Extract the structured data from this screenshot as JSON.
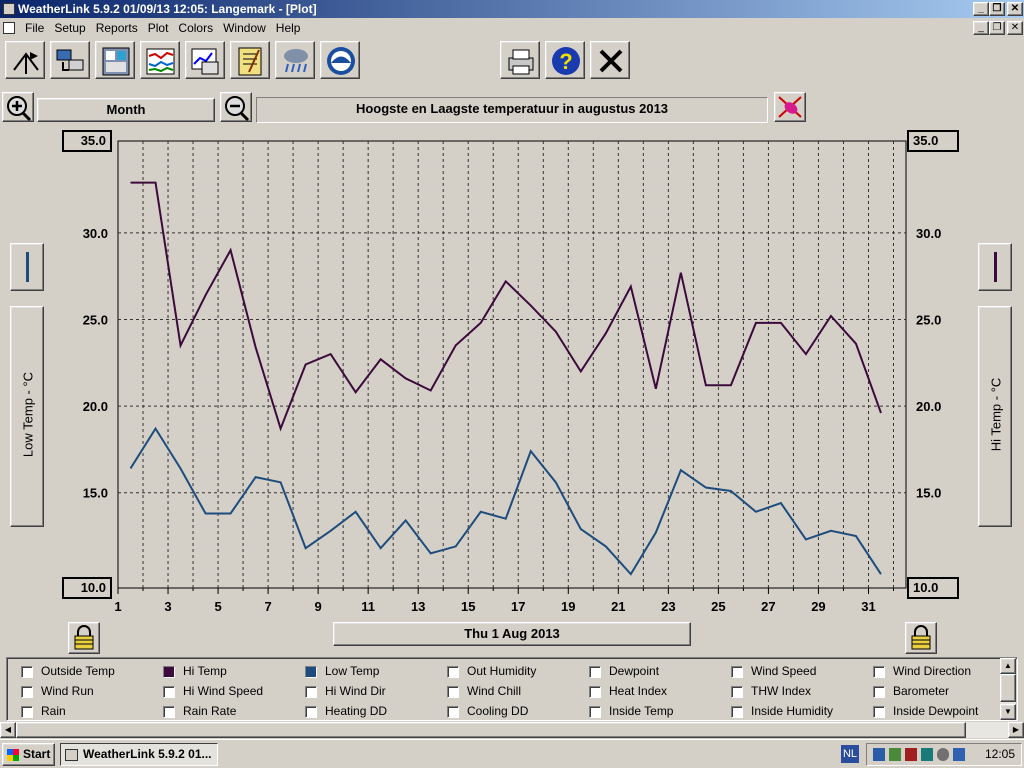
{
  "window": {
    "title": "WeatherLink 5.9.2  01/09/13  12:05: Langemark - [Plot]"
  },
  "menu": [
    "File",
    "Setup",
    "Reports",
    "Plot",
    "Colors",
    "Window",
    "Help"
  ],
  "toolbar": {
    "icons": [
      "station-icon",
      "download-icon",
      "bulletin-icon",
      "strip-chart-icon",
      "plot-icon",
      "notes-icon",
      "weather-icon",
      "noaa-icon"
    ],
    "right_icons": [
      "print-icon",
      "help-icon",
      "close-icon"
    ]
  },
  "plot_header": {
    "span": "Month",
    "title": "Hoogste en Laagste temperatuur in augustus 2013"
  },
  "axes": {
    "left_label": "Low Temp - °C",
    "right_label": "Hi Temp - °C",
    "y_ticks": [
      "35.0",
      "30.0",
      "25.0",
      "20.0",
      "15.0",
      "10.0"
    ],
    "x_ticks": [
      "1",
      "3",
      "5",
      "7",
      "9",
      "11",
      "13",
      "15",
      "17",
      "19",
      "21",
      "23",
      "25",
      "27",
      "29",
      "31"
    ],
    "date_label": "Thu 1 Aug 2013"
  },
  "chart_data": {
    "type": "line",
    "x": [
      1.5,
      2.5,
      3.5,
      4.5,
      5.5,
      6.5,
      7.5,
      8.5,
      9.5,
      10.5,
      11.5,
      12.5,
      13.5,
      14.5,
      15.5,
      16.5,
      17.5,
      18.5,
      19.5,
      20.5,
      21.5,
      22.5,
      23.5,
      24.5,
      25.5,
      26.5,
      27.5,
      28.5,
      29.5,
      30.5,
      31.5
    ],
    "xlim": [
      1,
      32.5
    ],
    "ylim": [
      9.5,
      35.3
    ],
    "series": [
      {
        "name": "Hi Temp",
        "color": "#3c0a3c",
        "values": [
          32.9,
          32.9,
          23.5,
          26.4,
          29.0,
          23.4,
          18.7,
          22.4,
          23.0,
          20.8,
          22.7,
          21.6,
          20.9,
          23.5,
          24.8,
          27.2,
          25.8,
          24.3,
          22.0,
          24.2,
          26.9,
          21.0,
          27.7,
          21.2,
          21.2,
          24.8,
          24.8,
          23.0,
          25.2,
          23.6,
          19.6
        ]
      },
      {
        "name": "Low Temp",
        "color": "#1e4c7c",
        "values": [
          16.4,
          18.7,
          16.4,
          13.8,
          13.8,
          15.9,
          15.6,
          11.8,
          12.8,
          13.9,
          11.8,
          13.4,
          11.5,
          11.9,
          13.9,
          13.5,
          17.4,
          15.6,
          12.9,
          11.9,
          10.3,
          12.7,
          16.3,
          15.3,
          15.1,
          13.9,
          14.4,
          12.3,
          12.8,
          12.5,
          10.3
        ]
      }
    ]
  },
  "legend": [
    [
      "Outside Temp",
      "Hi Temp",
      "Low Temp",
      "Out Humidity",
      "Dewpoint",
      "Wind Speed",
      "Wind Direction"
    ],
    [
      "Wind Run",
      "Hi Wind Speed",
      "Hi Wind Dir",
      "Wind Chill",
      "Heat Index",
      "THW Index",
      "Barometer"
    ],
    [
      "Rain",
      "Rain Rate",
      "Heating DD",
      "Cooling DD",
      "Inside Temp",
      "Inside Humidity",
      "Inside Dewpoint"
    ]
  ],
  "legend_checked": {
    "Hi Temp": "#3c0a3c",
    "Low Temp": "#1e4c7c"
  },
  "taskbar": {
    "start": "Start",
    "task": "WeatherLink 5.9.2  01...",
    "lang": "NL",
    "clock": "12:05"
  }
}
